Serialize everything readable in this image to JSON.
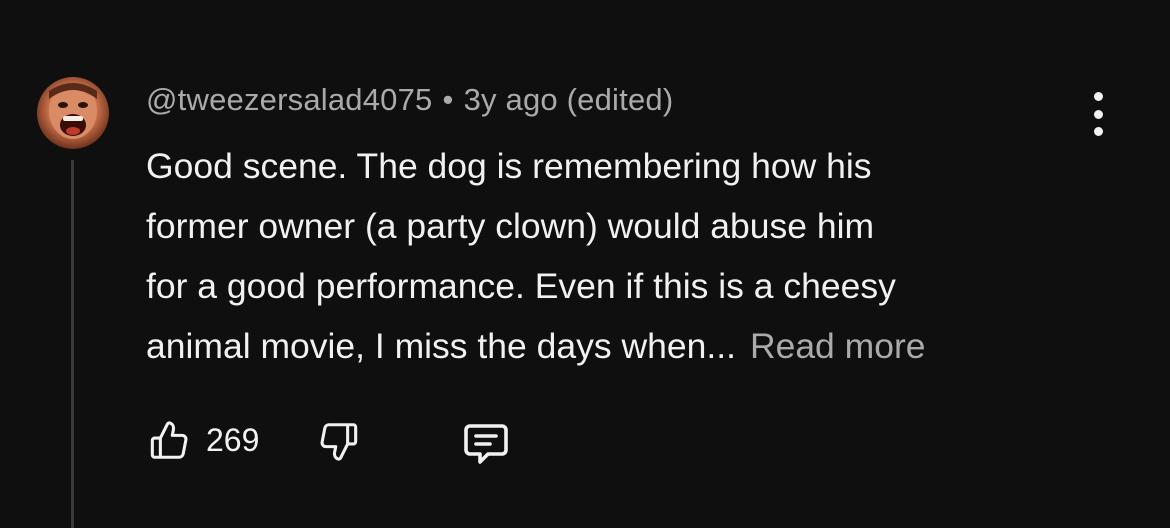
{
  "comment": {
    "author": "@tweezersalad4075",
    "separator": "•",
    "time": "3y ago (edited)",
    "text_lines": [
      "Good scene. The dog is remembering how his",
      "former owner (a party clown) would abuse him",
      "for a good performance. Even if this is a cheesy",
      "animal movie, I miss the days when..."
    ],
    "read_more": "Read more",
    "likes": "269"
  },
  "icons": {
    "avatar": "avatar",
    "more": "kebab-menu-icon",
    "like": "thumbs-up-icon",
    "dislike": "thumbs-down-icon",
    "reply": "comment-reply-icon"
  },
  "colors": {
    "background": "#0f0f0f",
    "primary_text": "#f1f1f1",
    "secondary_text": "#aaaaaa",
    "thread_line": "#3a3a3a"
  }
}
